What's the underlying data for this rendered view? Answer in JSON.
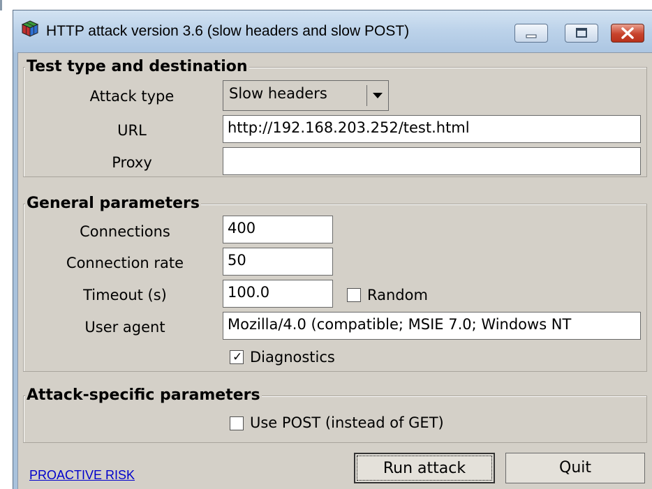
{
  "window": {
    "title": "HTTP attack version 3.6 (slow headers and slow POST)",
    "icon": "rubiks-cube-icon",
    "controls": [
      "minimize-icon",
      "maximize-icon",
      "close-icon"
    ]
  },
  "test_type": {
    "legend": "Test type and destination",
    "attack_type_label": "Attack type",
    "attack_type_value": "Slow headers",
    "url_label": "URL",
    "url_value": "http://192.168.203.252/test.html",
    "proxy_label": "Proxy",
    "proxy_value": ""
  },
  "general": {
    "legend": "General parameters",
    "connections_label": "Connections",
    "connections_value": "400",
    "rate_label": "Connection rate",
    "rate_value": "50",
    "timeout_label": "Timeout (s)",
    "timeout_value": "100.0",
    "random_label": "Random",
    "random_checked": false,
    "user_agent_label": "User agent",
    "user_agent_value": "Mozilla/4.0 (compatible; MSIE 7.0; Windows NT",
    "diagnostics_label": "Diagnostics",
    "diagnostics_checked": true
  },
  "attack_specific": {
    "legend": "Attack-specific parameters",
    "use_post_label": "Use POST (instead of GET)",
    "use_post_checked": false
  },
  "footer": {
    "link_text": "PROACTIVE RISK",
    "run_label": "Run attack",
    "quit_label": "Quit"
  },
  "colors": {
    "dialog_bg": "#d4d0c8",
    "titlebar": "#bdd3ea",
    "link": "#0000cc",
    "close_button": "#c8432c"
  }
}
